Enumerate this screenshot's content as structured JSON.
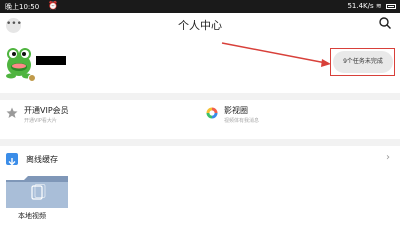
{
  "status_bar": {
    "time": "晚上10:50",
    "alarm_icon": "alarm-icon",
    "network": "51.4K/s",
    "wifi_icon": "wifi-icon",
    "battery_icon": "battery-icon"
  },
  "header": {
    "title": "个人中心",
    "back_icon": "message-icon",
    "search_icon": "search-icon"
  },
  "profile": {
    "avatar_icon": "frog-avatar",
    "task_button": "9个任务未完成"
  },
  "services": [
    {
      "title": "开通VIP会员",
      "subtitle": "开通VIP看大片",
      "icon": "star-icon"
    },
    {
      "title": "影视圈",
      "subtitle": "视频体有我消息",
      "icon": "color-circle-icon"
    }
  ],
  "offline": {
    "title": "离线缓存",
    "icon": "download-icon",
    "folder_label": "本地视频"
  },
  "colors": {
    "accent": "#d8403a",
    "link_blue": "#3b8de8",
    "avatar_green": "#4fb43f"
  }
}
